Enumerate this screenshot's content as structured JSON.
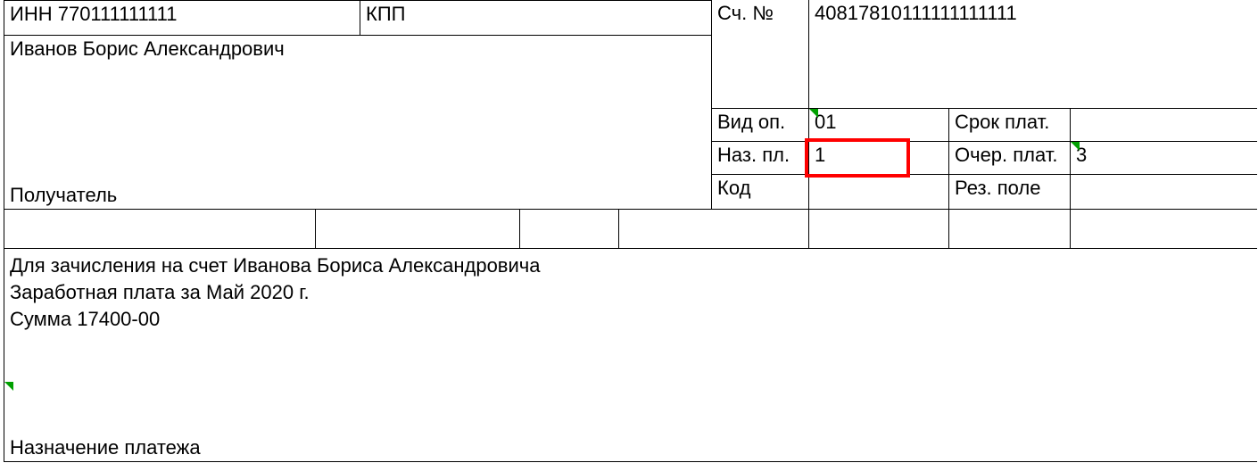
{
  "payer": {
    "inn_label": "ИНН",
    "inn_value": "770111111111",
    "kpp_label": "КПП",
    "kpp_value": "",
    "name": "Иванов Борис Александрович",
    "role_label": "Получатель"
  },
  "account": {
    "label": "Сч. №",
    "value": "40817810111111111111"
  },
  "op": {
    "vid_op_label": "Вид оп.",
    "vid_op_value": "01",
    "srok_plat_label": "Срок плат.",
    "srok_plat_value": "",
    "naz_pl_label": "Наз. пл.",
    "naz_pl_value": "1",
    "ocher_plat_label": "Очер. плат.",
    "ocher_plat_value": "3",
    "kod_label": "Код",
    "kod_value": "",
    "rez_pole_label": "Рез. поле",
    "rez_pole_value": ""
  },
  "purpose": {
    "line1": "Для зачисления на счет Иванова Бориса Александровича",
    "line2": "Заработная плата за Май 2020 г.",
    "line3": "Сумма 17400-00",
    "label": "Назначение платежа"
  }
}
